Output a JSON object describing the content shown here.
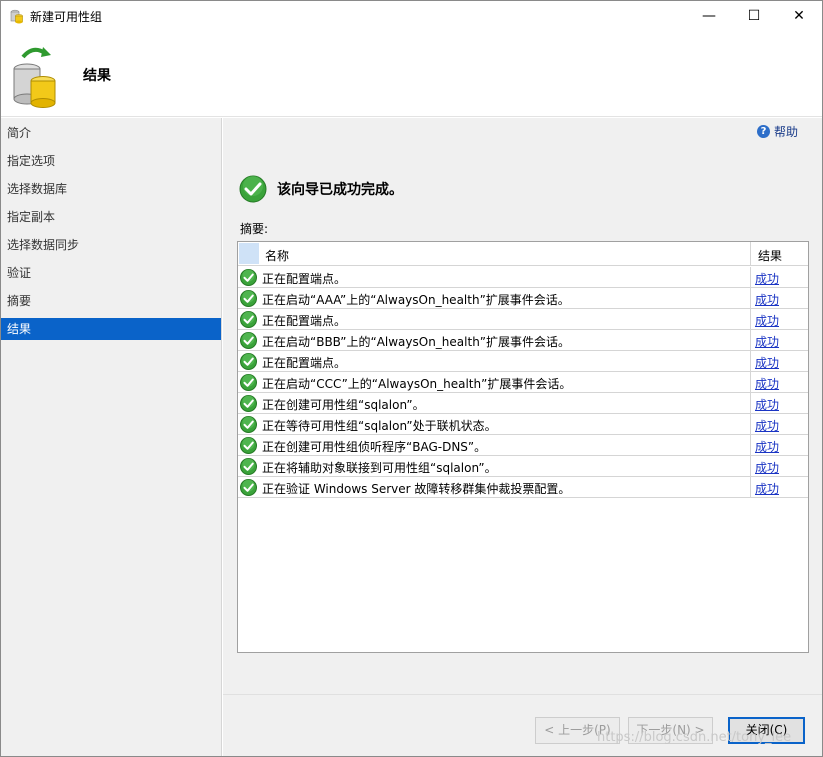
{
  "window": {
    "title": "新建可用性组",
    "minimize": "—",
    "maximize": "☐",
    "close": "✕"
  },
  "header": {
    "title": "结果"
  },
  "sidebar": {
    "items": [
      {
        "label": "简介",
        "active": false
      },
      {
        "label": "指定选项",
        "active": false
      },
      {
        "label": "选择数据库",
        "active": false
      },
      {
        "label": "指定副本",
        "active": false
      },
      {
        "label": "选择数据同步",
        "active": false
      },
      {
        "label": "验证",
        "active": false
      },
      {
        "label": "摘要",
        "active": false
      },
      {
        "label": "结果",
        "active": true
      }
    ]
  },
  "main": {
    "help_label": "帮助",
    "help_icon": "?",
    "success_message": "该向导已成功完成。",
    "summary_label": "摘要:",
    "table": {
      "col_name": "名称",
      "col_result": "结果",
      "rows": [
        {
          "message": "正在配置端点。",
          "result": "成功"
        },
        {
          "message": "正在启动“AAA”上的“AlwaysOn_health”扩展事件会话。",
          "result": "成功"
        },
        {
          "message": "正在配置端点。",
          "result": "成功"
        },
        {
          "message": "正在启动“BBB”上的“AlwaysOn_health”扩展事件会话。",
          "result": "成功"
        },
        {
          "message": "正在配置端点。",
          "result": "成功"
        },
        {
          "message": "正在启动“CCC”上的“AlwaysOn_health”扩展事件会话。",
          "result": "成功"
        },
        {
          "message": "正在创建可用性组“sqlalon”。",
          "result": "成功"
        },
        {
          "message": "正在等待可用性组“sqlalon”处于联机状态。",
          "result": "成功"
        },
        {
          "message": "正在创建可用性组侦听程序“BAG-DNS”。",
          "result": "成功"
        },
        {
          "message": "正在将辅助对象联接到可用性组“sqlalon”。",
          "result": "成功"
        },
        {
          "message": "正在验证 Windows Server 故障转移群集仲裁投票配置。",
          "result": "成功"
        }
      ]
    }
  },
  "footer": {
    "prev_label": "< 上一步(P)",
    "next_label": "下一步(N) >",
    "close_label": "关闭(C)"
  },
  "watermark": "https://blog.csdn.net/tony_lee",
  "colors": {
    "accent": "#0a63c9",
    "link": "#1a34c4",
    "success_green": "#3aa33a"
  }
}
